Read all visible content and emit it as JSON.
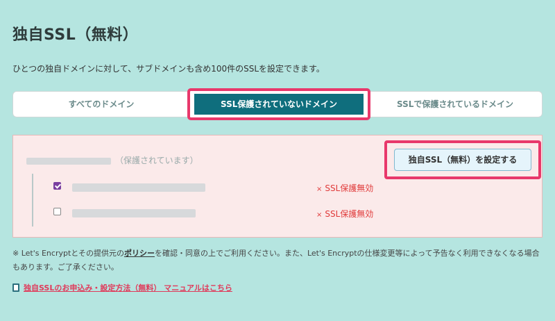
{
  "page": {
    "title": "独自SSL（無料）",
    "description": "ひとつの独自ドメインに対して、サブドメインも含め100件のSSLを設定できます。"
  },
  "tabs": [
    {
      "label": "すべてのドメイン",
      "active": false
    },
    {
      "label": "SSL保護されていないドメイン",
      "active": true
    },
    {
      "label": "SSLで保護されているドメイン",
      "active": false
    }
  ],
  "domain": {
    "status_suffix": "（保護されています）",
    "subdomains": [
      {
        "checked": true,
        "status": "SSL保護無効"
      },
      {
        "checked": false,
        "status": "SSL保護無効"
      }
    ]
  },
  "actions": {
    "set_ssl_button": "独自SSL（無料）を設定する"
  },
  "notes": {
    "prefix": "※ Let's Encryptとその提供元の",
    "policy_link": "ポリシー",
    "suffix": "を確認・同意の上でご利用ください。また、Let's Encryptの仕様変更等によって予告なく利用できなくなる場合もあります。ご了承ください。",
    "manual_link": "独自SSLのお申込み・設定方法（無料） マニュアルはこちら"
  },
  "icons": {
    "error": "×",
    "manual": "book-icon"
  },
  "colors": {
    "background": "#b5e5e0",
    "active_tab": "#0f6e7d",
    "highlight": "#e8386b",
    "error": "#e03a3a",
    "panel": "#fbeaea"
  }
}
